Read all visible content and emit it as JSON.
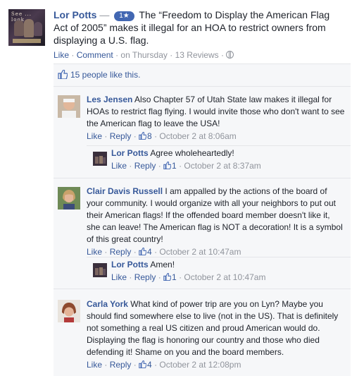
{
  "post": {
    "author": "Lor Potts",
    "separator": "—",
    "badge": "1★",
    "text": "The “Freedom to Display the American Flag Act of 2005” makes it illegal for an HOA to restrict owners from displaying a U.S. flag.",
    "meta": {
      "like": "Like",
      "comment": "Comment",
      "time": "on Thursday",
      "reviews": "13 Reviews"
    },
    "avatar_text": "See ... look"
  },
  "likes": {
    "text": "15 people like this."
  },
  "comments": [
    {
      "name": "Les Jensen",
      "text": "Also Chapter 57 of Utah State law makes it illegal for HOAs to restrict flag flying. I would invite those who don't want to see the American flag to leave the USA!",
      "like": "Like",
      "reply": "Reply",
      "count": "8",
      "time": "October 2 at 8:06am",
      "replies": [
        {
          "name": "Lor Potts",
          "text": "Agree wholeheartedly!",
          "like": "Like",
          "reply": "Reply",
          "count": "1",
          "time": "October 2 at 8:37am"
        }
      ]
    },
    {
      "name": "Clair Davis Russell",
      "text": "I am appalled by the actions of the board of your community. I would organize with all your neighbors to put out their American flags! If the offended board member doesn't like it, she can leave! The American flag is NOT a decoration! It is a symbol of this great country!",
      "like": "Like",
      "reply": "Reply",
      "count": "4",
      "time": "October 2 at 10:47am",
      "replies": [
        {
          "name": "Lor Potts",
          "text": "Amen!",
          "like": "Like",
          "reply": "Reply",
          "count": "1",
          "time": "October 2 at 10:47am"
        }
      ]
    },
    {
      "name": "Carla York",
      "text": "What kind of power trip are you on Lyn? Maybe you should find somewhere else to live (not in the US). That is definitely not something a real US citizen and proud American would do. Displaying the flag is honoring our country and those who died defending it! Shame on you and the board members.",
      "like": "Like",
      "reply": "Reply",
      "count": "4",
      "time": "October 2 at 12:08pm",
      "replies": []
    }
  ],
  "colors": {
    "link": "#365899",
    "meta": "#90949c",
    "panel": "#f6f7f9",
    "badge": "#4267b2"
  }
}
